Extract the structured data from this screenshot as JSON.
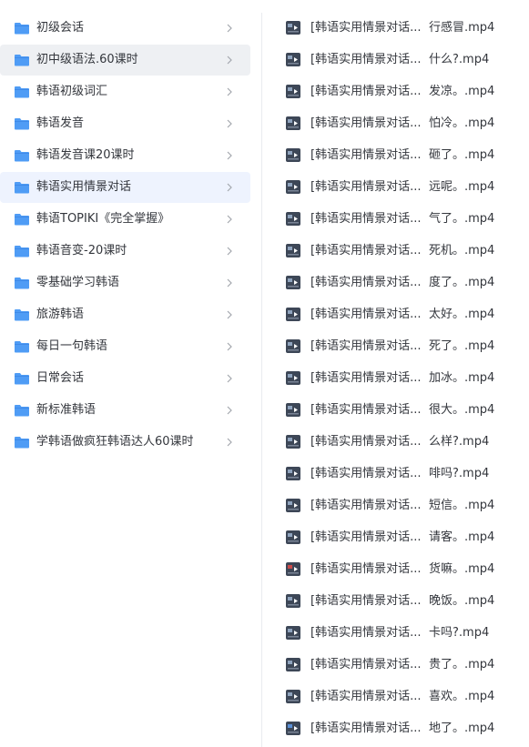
{
  "folders": [
    {
      "name": "初级会话"
    },
    {
      "name": "初中级语法.60课时"
    },
    {
      "name": "韩语初级词汇"
    },
    {
      "name": "韩语发音"
    },
    {
      "name": "韩语发音课20课时"
    },
    {
      "name": "韩语实用情景对话"
    },
    {
      "name": "韩语TOPIKI《完全掌握》"
    },
    {
      "name": "韩语音变-20课时"
    },
    {
      "name": "零基础学习韩语"
    },
    {
      "name": "旅游韩语"
    },
    {
      "name": "每日一句韩语"
    },
    {
      "name": "日常会话"
    },
    {
      "name": "新标准韩语"
    },
    {
      "name": "学韩语做疯狂韩语达人60课时"
    }
  ],
  "files": [
    {
      "prefix": "[韩语实用情景对话...",
      "suffix": "行感冒.mp4"
    },
    {
      "prefix": "[韩语实用情景对话...",
      "suffix": "什么?.mp4"
    },
    {
      "prefix": "[韩语实用情景对话...",
      "suffix": "发凉。.mp4"
    },
    {
      "prefix": "[韩语实用情景对话...",
      "suffix": "怕冷。.mp4"
    },
    {
      "prefix": "[韩语实用情景对话...",
      "suffix": "砸了。.mp4"
    },
    {
      "prefix": "[韩语实用情景对话...",
      "suffix": "远呢。.mp4"
    },
    {
      "prefix": "[韩语实用情景对话...",
      "suffix": "气了。.mp4"
    },
    {
      "prefix": "[韩语实用情景对话...",
      "suffix": "死机。.mp4"
    },
    {
      "prefix": "[韩语实用情景对话...",
      "suffix": "度了。.mp4"
    },
    {
      "prefix": "[韩语实用情景对话...",
      "suffix": "太好。.mp4"
    },
    {
      "prefix": "[韩语实用情景对话...",
      "suffix": "死了。.mp4"
    },
    {
      "prefix": "[韩语实用情景对话...",
      "suffix": "加冰。.mp4"
    },
    {
      "prefix": "[韩语实用情景对话...",
      "suffix": "很大。.mp4"
    },
    {
      "prefix": "[韩语实用情景对话...",
      "suffix": "么样?.mp4"
    },
    {
      "prefix": "[韩语实用情景对话...",
      "suffix": "啡吗?.mp4"
    },
    {
      "prefix": "[韩语实用情景对话...",
      "suffix": "短信。.mp4"
    },
    {
      "prefix": "[韩语实用情景对话...",
      "suffix": "请客。.mp4"
    },
    {
      "prefix": "[韩语实用情景对话...",
      "suffix": "货嘛。.mp4"
    },
    {
      "prefix": "[韩语实用情景对话...",
      "suffix": "晚饭。.mp4"
    },
    {
      "prefix": "[韩语实用情景对话...",
      "suffix": "卡吗?.mp4"
    },
    {
      "prefix": "[韩语实用情景对话...",
      "suffix": "贵了。.mp4"
    },
    {
      "prefix": "[韩语实用情景对话...",
      "suffix": "喜欢。.mp4"
    },
    {
      "prefix": "[韩语实用情景对话...",
      "suffix": "地了。.mp4"
    }
  ],
  "colors": {
    "folder_icon": "#4f9cf5",
    "folder_icon_tab": "#3f8ae8",
    "selected_row": "#eef3fe",
    "hover_row": "#eef0f3",
    "chevron": "#a3a7ae",
    "video_thumb_bg": "#3d4757"
  },
  "icons": {
    "folder": "folder-icon",
    "chevron": "chevron-right-icon",
    "video": "video-thumbnail-icon"
  }
}
